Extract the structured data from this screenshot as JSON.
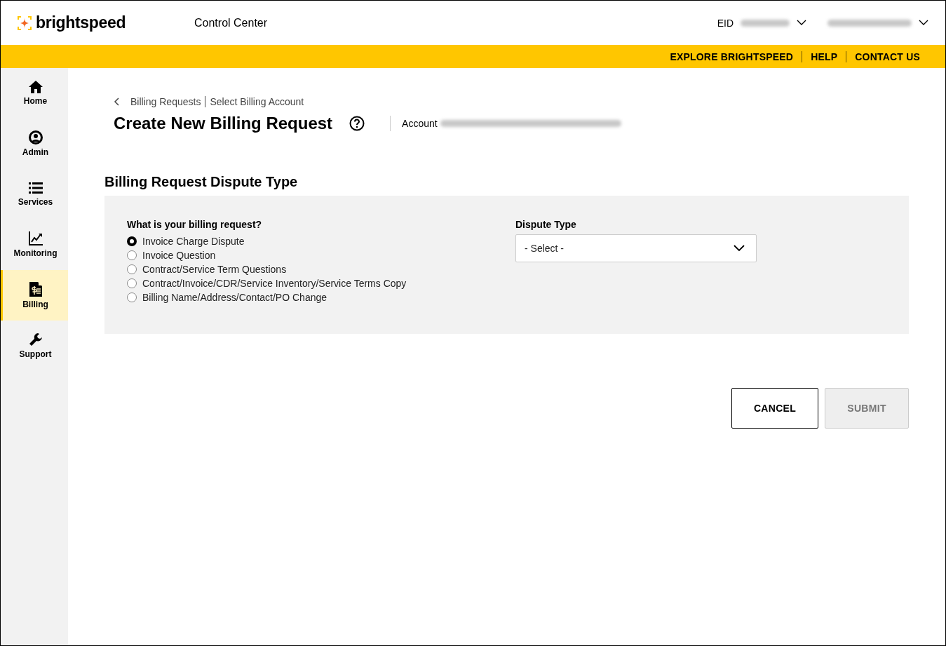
{
  "header": {
    "logo": "brightspeed",
    "title": "Control Center",
    "eid_label": "EID"
  },
  "top_links": [
    "EXPLORE BRIGHTSPEED",
    "HELP",
    "CONTACT US"
  ],
  "sidebar": {
    "items": [
      {
        "label": "Home",
        "selected": false
      },
      {
        "label": "Admin",
        "selected": false
      },
      {
        "label": "Services",
        "selected": false
      },
      {
        "label": "Monitoring",
        "selected": false
      },
      {
        "label": "Billing",
        "selected": true
      },
      {
        "label": "Support",
        "selected": false
      }
    ]
  },
  "breadcrumb": [
    "Billing Requests",
    "Select Billing Account"
  ],
  "page_title": "Create New Billing Request",
  "account_label": "Account",
  "section_title": "Billing Request Dispute Type",
  "question": {
    "label": "What is your billing request?",
    "options": [
      {
        "label": "Invoice Charge Dispute",
        "selected": true
      },
      {
        "label": "Invoice Question",
        "selected": false
      },
      {
        "label": "Contract/Service Term Questions",
        "selected": false
      },
      {
        "label": "Contract/Invoice/CDR/Service Inventory/Service Terms Copy",
        "selected": false
      },
      {
        "label": "Billing Name/Address/Contact/PO Change",
        "selected": false
      }
    ]
  },
  "dispute_type": {
    "label": "Dispute Type",
    "value": "- Select -"
  },
  "buttons": [
    {
      "label": "CANCEL",
      "disabled": false
    },
    {
      "label": "SUBMIT",
      "disabled": true
    }
  ]
}
